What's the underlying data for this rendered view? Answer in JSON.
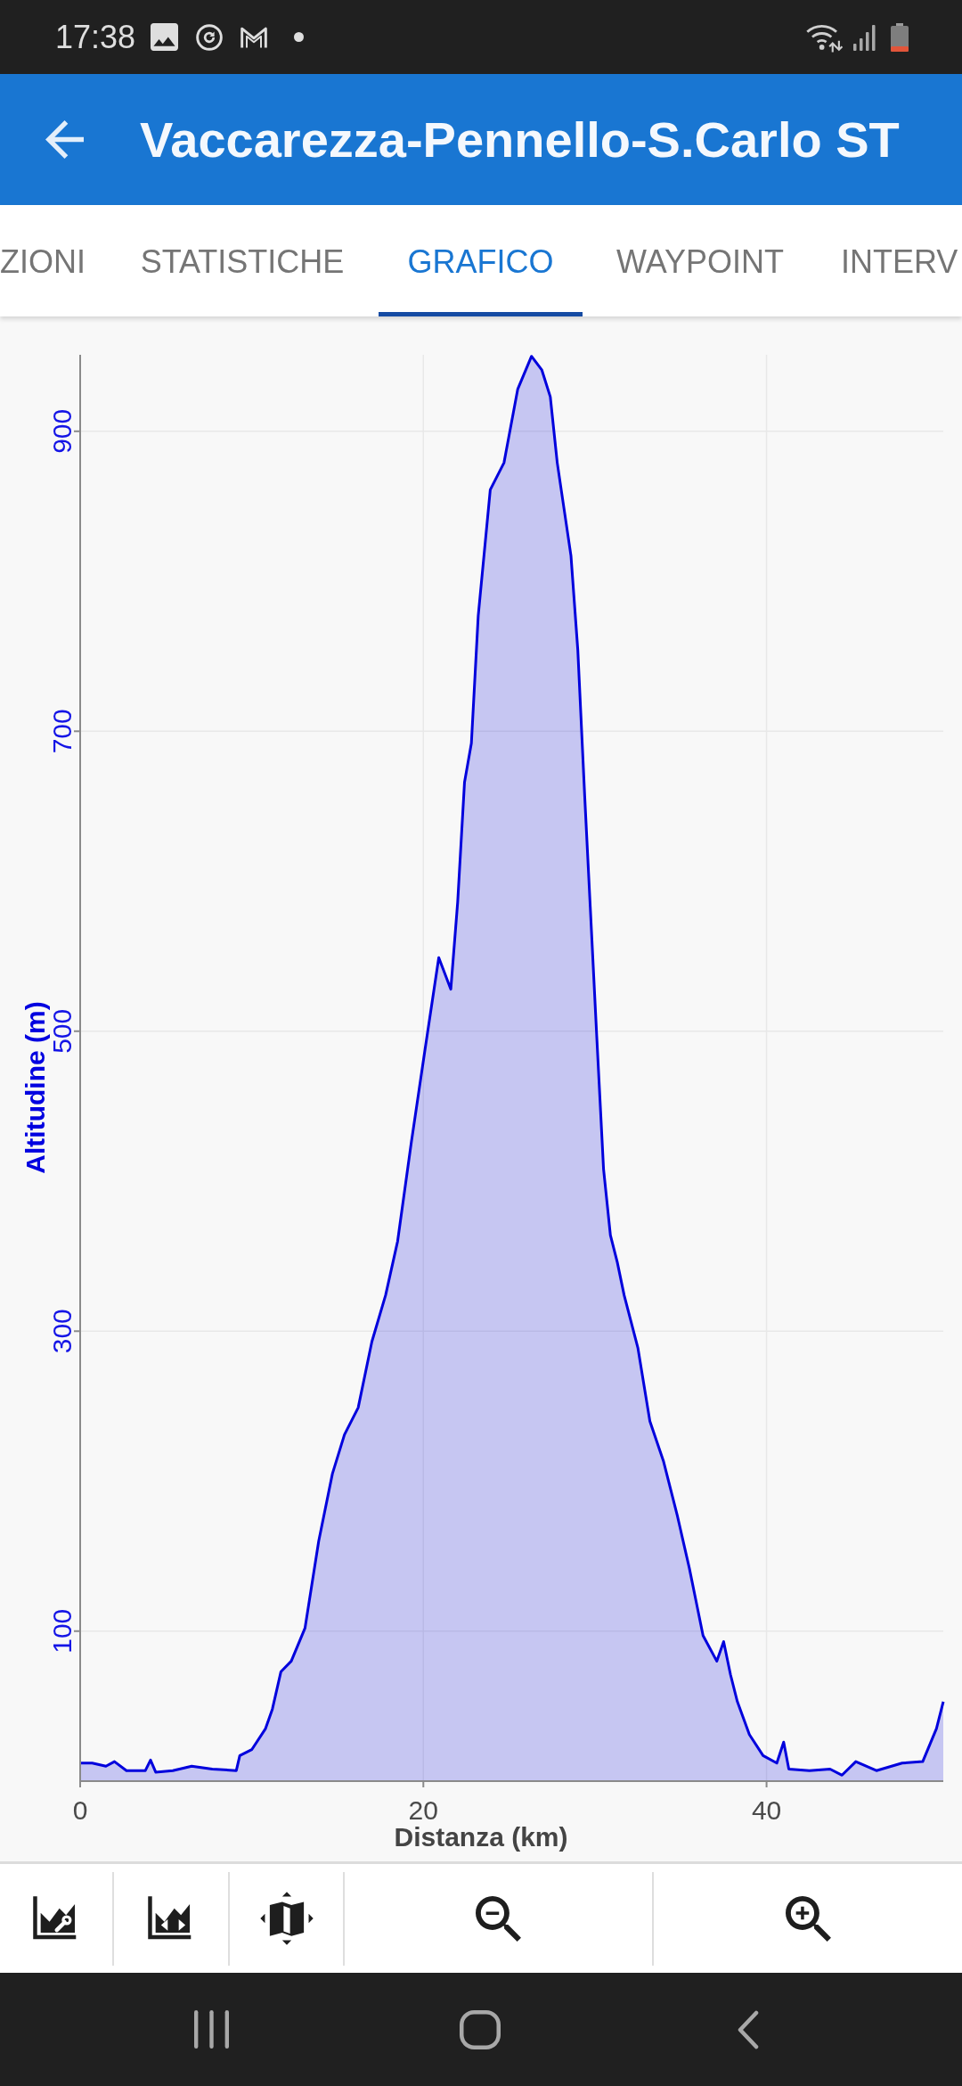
{
  "status_bar": {
    "time": "17:38"
  },
  "app_bar": {
    "title": "Vaccarezza-Pennello-S.Carlo ST"
  },
  "tabs": [
    {
      "label": "ZIONI",
      "selected": false
    },
    {
      "label": "STATISTICHE",
      "selected": false
    },
    {
      "label": "GRAFICO",
      "selected": true
    },
    {
      "label": "WAYPOINT",
      "selected": false
    },
    {
      "label": "INTERV",
      "selected": false
    }
  ],
  "chart": {
    "chart_data": {
      "type": "area",
      "xlabel": "Distanza (km)",
      "ylabel": "Altitudine (m)",
      "x": [
        0,
        0.7,
        1.5,
        2.0,
        2.7,
        3.8,
        4.1,
        4.4,
        5.4,
        6.5,
        7.7,
        9.1,
        9.3,
        10.0,
        10.8,
        11.2,
        11.7,
        12.3,
        13.1,
        13.9,
        14.7,
        15.4,
        16.2,
        17.0,
        17.8,
        18.5,
        19.3,
        20.1,
        20.9,
        21.6,
        22.0,
        22.4,
        22.8,
        23.2,
        23.9,
        24.7,
        25.5,
        26.3,
        26.9,
        27.4,
        27.8,
        28.6,
        29.0,
        29.4,
        30.1,
        30.5,
        30.9,
        31.3,
        31.7,
        32.5,
        33.2,
        34.0,
        34.8,
        35.5,
        36.3,
        37.1,
        37.5,
        37.9,
        38.3,
        39.0,
        39.8,
        40.6,
        41.0,
        41.3,
        42.5,
        43.7,
        44.4,
        45.2,
        46.4,
        47.9,
        49.1,
        49.9,
        50.3
      ],
      "series": [
        {
          "color": "#0000dd",
          "values": [
            12,
            12,
            10,
            13,
            7,
            7,
            14,
            6,
            7,
            10,
            8,
            7,
            17,
            21,
            35,
            48,
            73,
            80,
            102,
            160,
            205,
            231,
            249,
            293,
            324,
            360,
            426,
            488,
            549,
            528,
            586,
            666,
            692,
            777,
            861,
            879,
            928,
            950,
            941,
            923,
            879,
            817,
            754,
            657,
            497,
            408,
            364,
            346,
            324,
            289,
            240,
            213,
            177,
            142,
            97,
            80,
            93,
            71,
            53,
            31,
            17,
            12,
            26,
            8,
            7,
            8,
            4,
            13,
            7,
            12,
            13,
            35,
            53
          ]
        }
      ],
      "xlim": [
        0,
        50.3
      ],
      "ylim": [
        0,
        951
      ],
      "xticks": [
        0,
        20,
        40
      ],
      "yticks": [
        100,
        300,
        500,
        700,
        900
      ],
      "grid": true
    }
  }
}
